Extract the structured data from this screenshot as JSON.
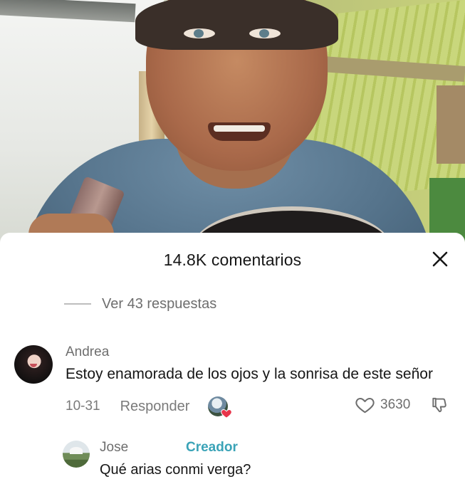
{
  "video": {
    "description_icon": "video-frame"
  },
  "sheet": {
    "title": "14.8K comentarios",
    "close_icon": "close-icon"
  },
  "replies": {
    "label": "Ver 43 respuestas"
  },
  "comments": [
    {
      "author": "Andrea",
      "text": "Estoy enamorada de los ojos y la sonrisa de este señor",
      "date": "10-31",
      "reply_label": "Responder",
      "likes": "3630",
      "like_icon": "heart-outline-icon",
      "dislike_icon": "thumbs-down-icon",
      "creator_liked_icon": "red-heart-icon"
    },
    {
      "author": "Jose",
      "badge": "Creador",
      "text": "Qué arias conmi verga?"
    }
  ],
  "colors": {
    "creator_badge": "#3aa3b7",
    "heart": "#e8344a",
    "primary_text": "#161616",
    "secondary_text": "#6e6e6e"
  }
}
